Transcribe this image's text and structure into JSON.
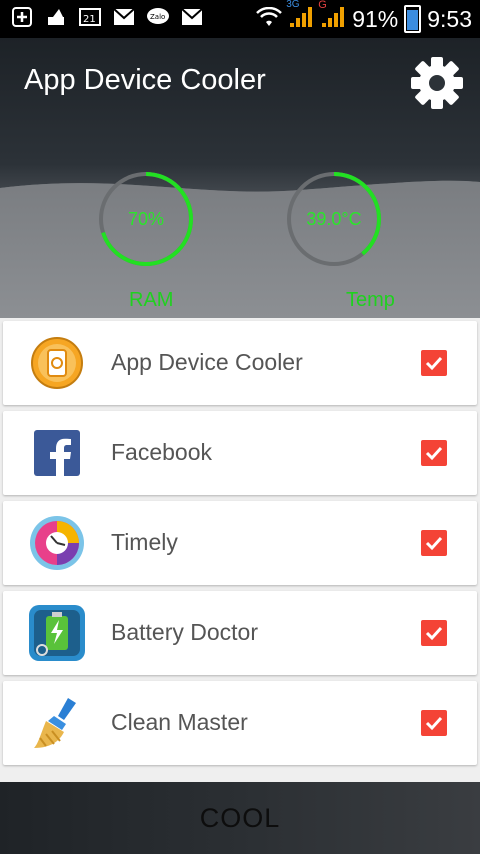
{
  "status_bar": {
    "battery_percent": "91%",
    "time": "9:53",
    "network_3g": "3G",
    "network_g": "G"
  },
  "header": {
    "title": "App Device Cooler",
    "settings_icon": "gear-icon"
  },
  "gauges": {
    "ram": {
      "value_text": "70%",
      "label": "RAM",
      "fraction": 0.7
    },
    "temp": {
      "value_text": "39.0°C",
      "label": "Temp",
      "fraction": 0.39
    }
  },
  "apps": [
    {
      "name": "App Device Cooler",
      "icon": "app-device-cooler-icon",
      "checked": true
    },
    {
      "name": "Facebook",
      "icon": "facebook-icon",
      "checked": true
    },
    {
      "name": "Timely",
      "icon": "timely-icon",
      "checked": true
    },
    {
      "name": "Battery Doctor",
      "icon": "battery-doctor-icon",
      "checked": true
    },
    {
      "name": "Clean Master",
      "icon": "clean-master-icon",
      "checked": true
    }
  ],
  "action": {
    "cool_label": "COOL"
  },
  "colors": {
    "accent_green": "#22e022",
    "checkbox_red": "#f44336"
  }
}
